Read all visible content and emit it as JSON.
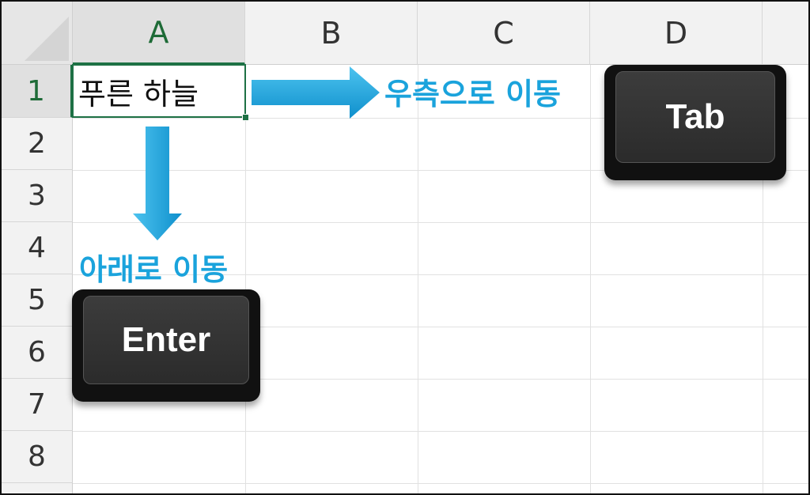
{
  "columns": [
    "A",
    "B",
    "C",
    "D"
  ],
  "rows": [
    "1",
    "2",
    "3",
    "4",
    "5",
    "6",
    "7",
    "8"
  ],
  "active_cell": {
    "column": "A",
    "row": "1",
    "value": "푸른 하늘"
  },
  "annotations": {
    "right_label": "우측으로 이동",
    "down_label": "아래로 이동"
  },
  "keys": {
    "tab": "Tab",
    "enter": "Enter"
  },
  "colors": {
    "accent_arrow": "#1aa3dc",
    "selection_border": "#1e7145",
    "key_body": "#2b2b2b"
  }
}
